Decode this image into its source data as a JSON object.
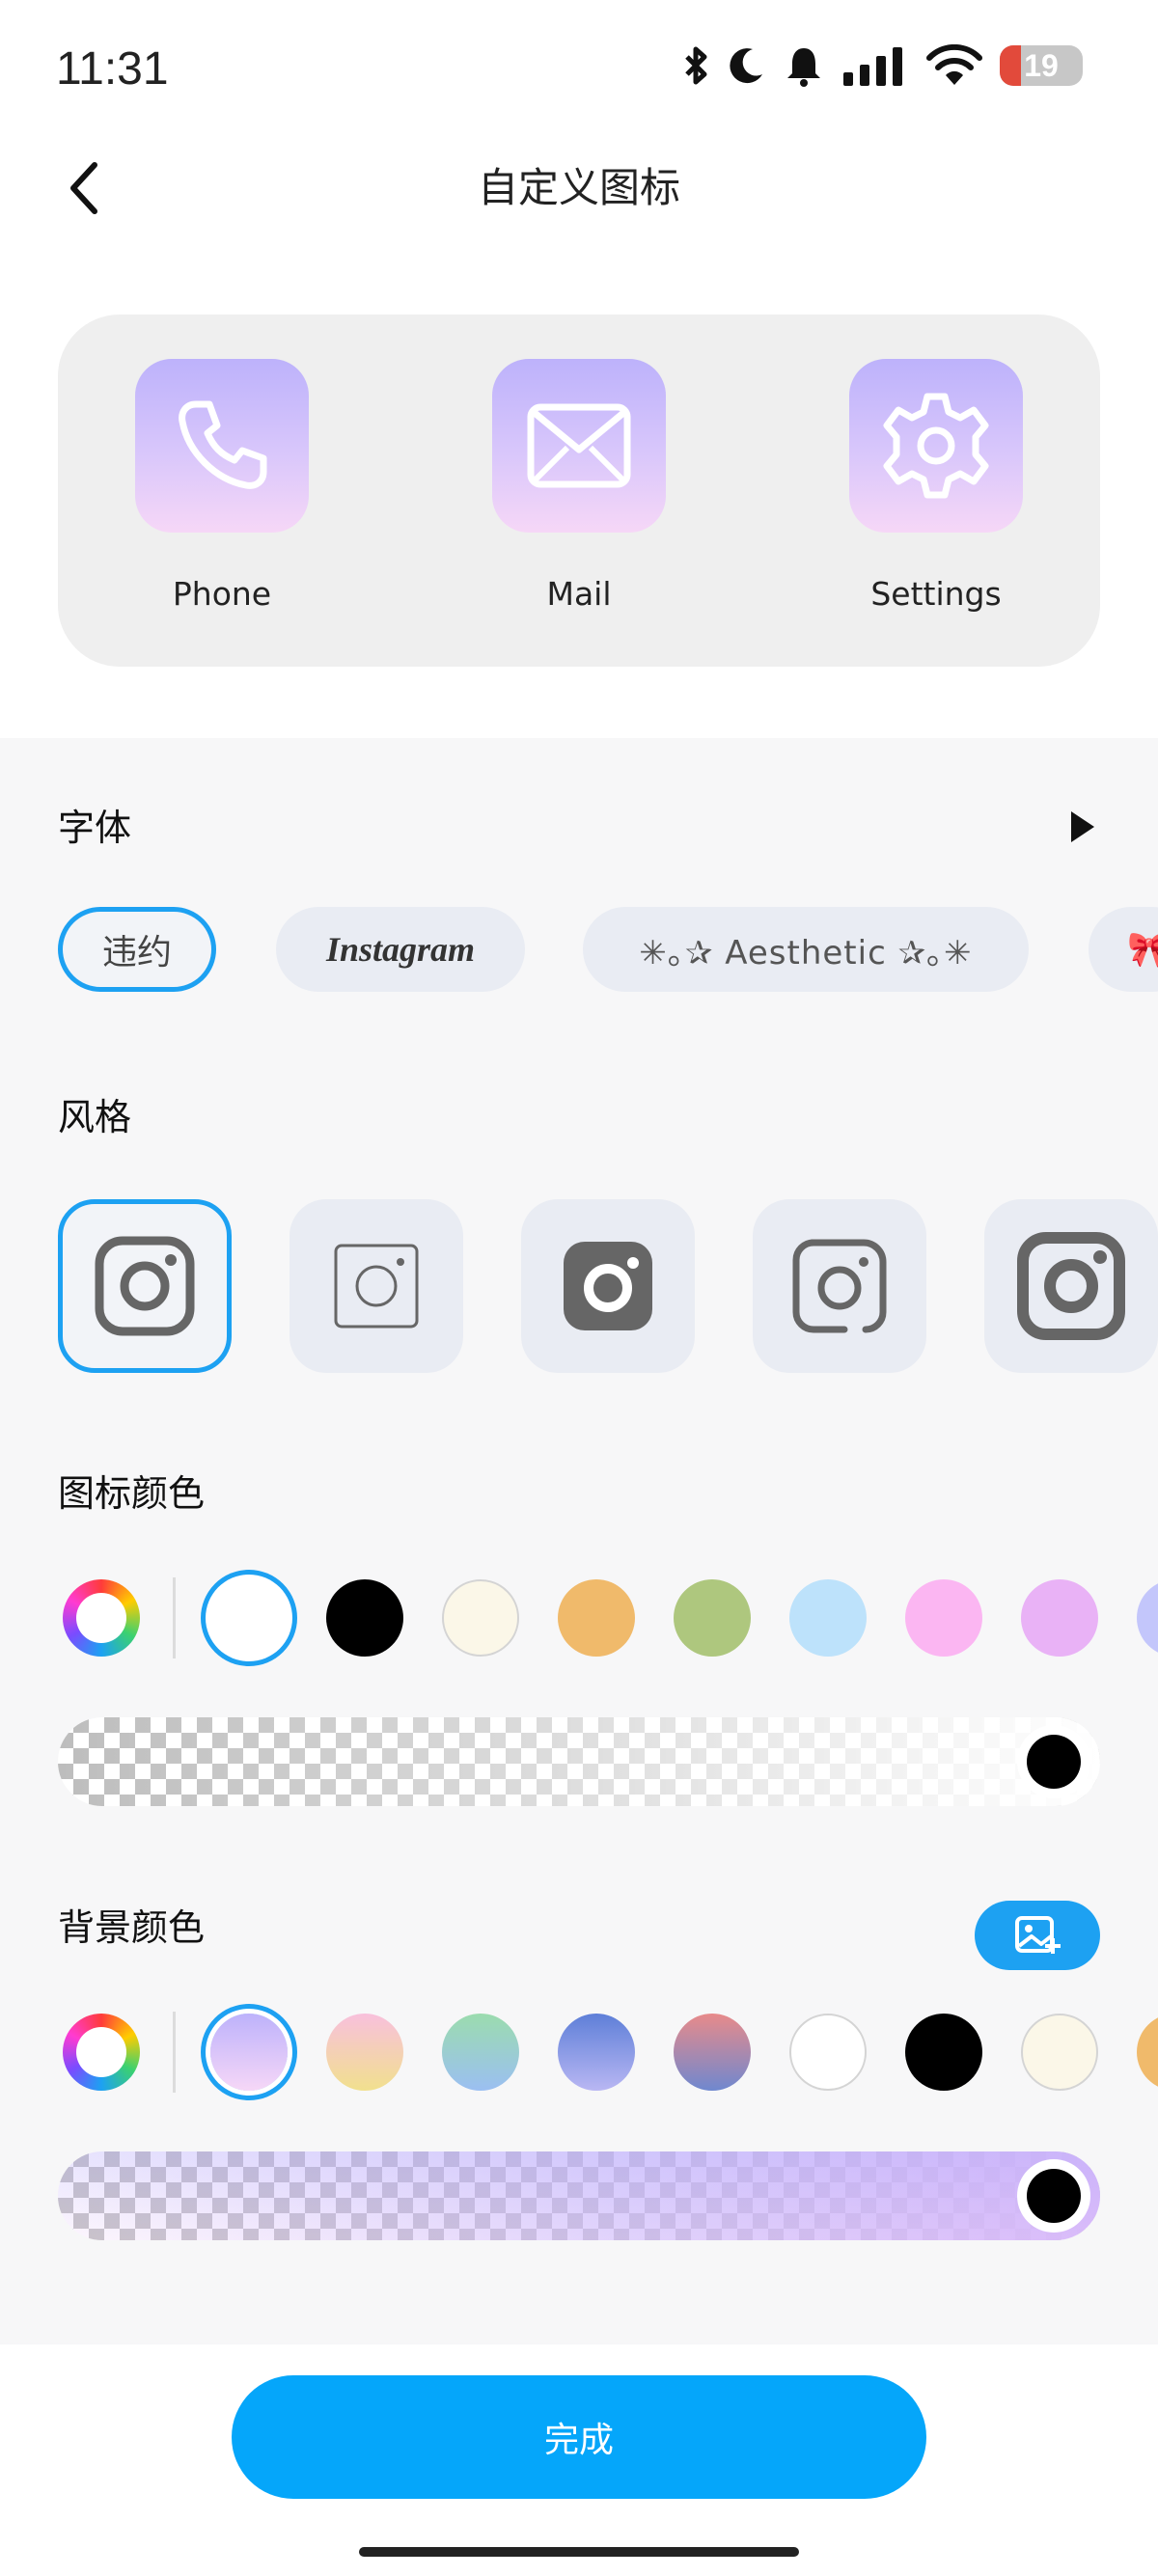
{
  "status_bar": {
    "time": "11:31",
    "battery": "19",
    "icons": [
      "bluetooth-icon",
      "moon-icon",
      "bell-icon",
      "signal-icon",
      "wifi-icon",
      "battery-icon"
    ]
  },
  "header": {
    "title": "自定义图标",
    "back_icon": "chevron-left-icon"
  },
  "preview": {
    "items": [
      {
        "label": "Phone",
        "icon": "phone-icon"
      },
      {
        "label": "Mail",
        "icon": "mail-icon"
      },
      {
        "label": "Settings",
        "icon": "gear-icon"
      }
    ]
  },
  "font_section": {
    "title": "字体",
    "chips": [
      {
        "label": "违约",
        "selected": true
      },
      {
        "label": "Instagram",
        "selected": false
      },
      {
        "label": "✳︎｡✰ Aesthetic ✰｡✳︎",
        "selected": false
      },
      {
        "label": "🎀",
        "selected": false
      }
    ]
  },
  "style_section": {
    "title": "风格",
    "styles": [
      "outline-rounded",
      "thin-square",
      "filled",
      "broken-outline",
      "thick-outline"
    ],
    "selected_index": 0
  },
  "icon_color_section": {
    "title": "图标颜色",
    "swatches": [
      "#ffffff",
      "#000000",
      "#fbf7e8",
      "#f0ba6b",
      "#aec77e",
      "#bde2fb",
      "#fbb6f2",
      "#e9b2f6",
      "#c3c6fb"
    ],
    "selected_index": 0,
    "opacity": 1.0
  },
  "bg_color_section": {
    "title": "背景颜色",
    "image_button_icon": "image-add-icon",
    "swatches": [
      "gradient-lavender-pink",
      "gradient-pink-yellow",
      "gradient-mint-blue",
      "gradient-blue",
      "gradient-rose-blue",
      "#ffffff",
      "#000000",
      "#fbf7e8",
      "#f0ba6b"
    ],
    "selected_index": 0,
    "opacity": 1.0
  },
  "done_button": {
    "label": "完成"
  },
  "colors": {
    "accent": "#1da1f2",
    "done": "#05a6fa",
    "icon_gradient_top": "#bdb2fb",
    "icon_gradient_bottom": "#f6d7f7"
  }
}
